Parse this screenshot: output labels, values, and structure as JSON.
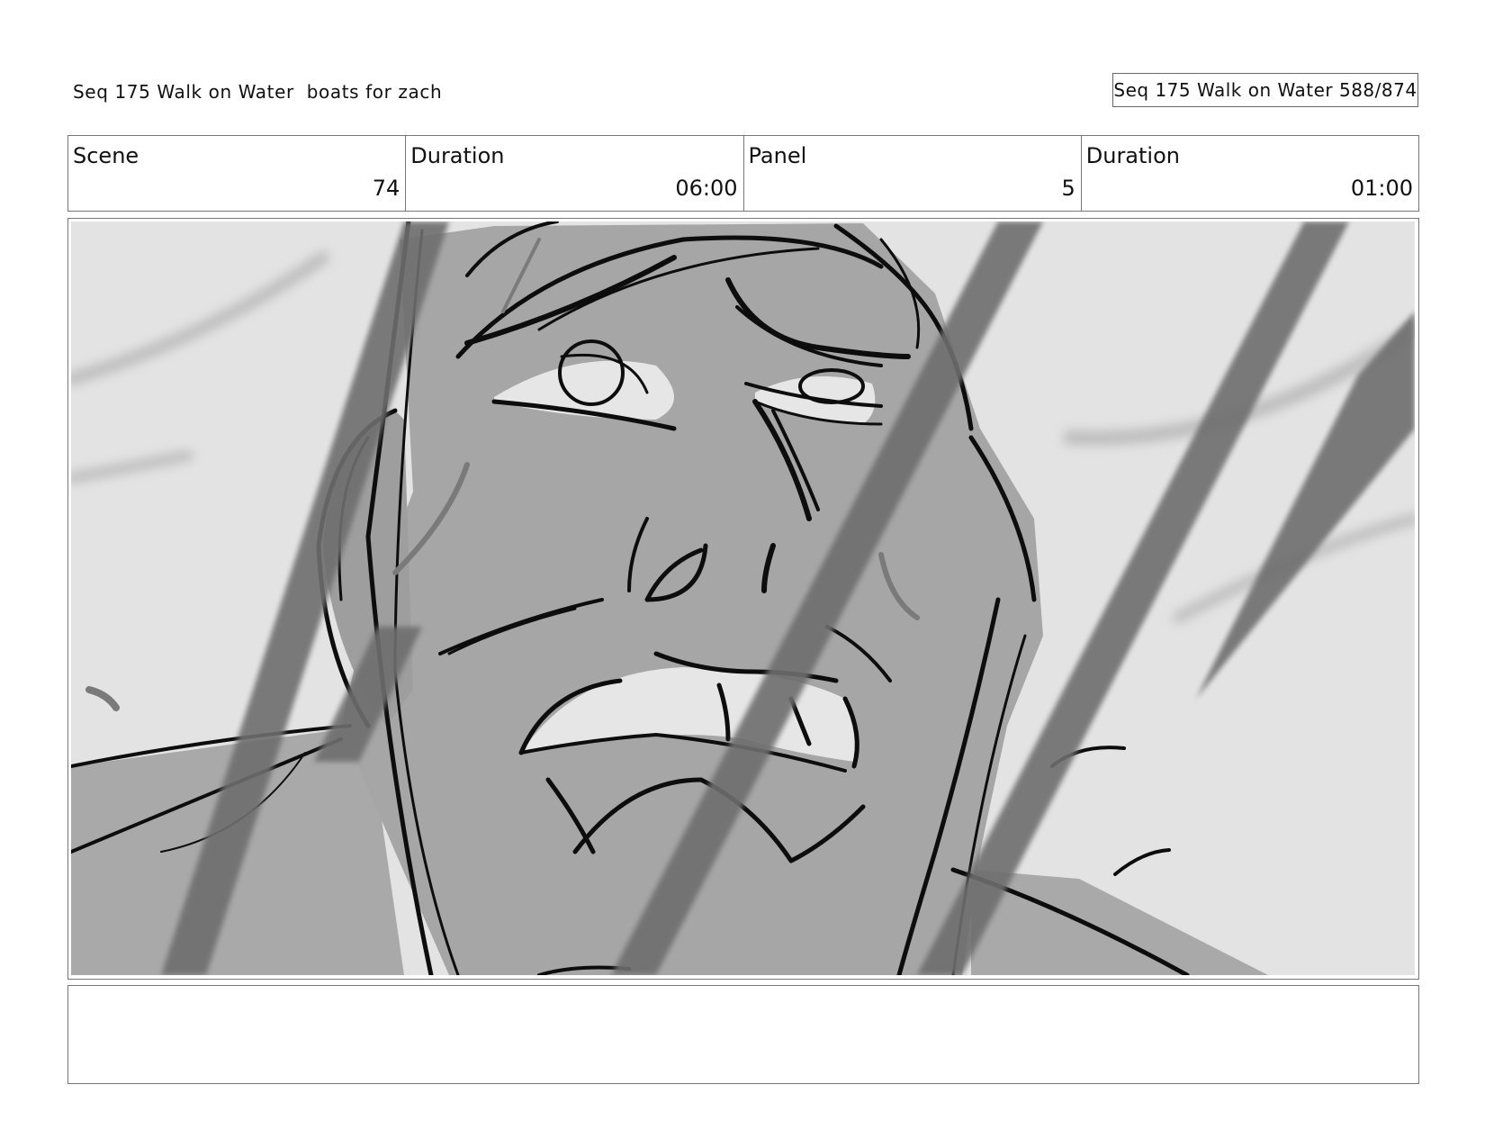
{
  "header": {
    "title": "Seq 175 Walk on Water  boats for zach",
    "page_label": "Seq 175 Walk on Water 588/874"
  },
  "info": {
    "scene_label": "Scene",
    "scene_value": "74",
    "scene_duration_label": "Duration",
    "scene_duration_value": "06:00",
    "panel_label": "Panel",
    "panel_value": "5",
    "panel_duration_label": "Duration",
    "panel_duration_value": "01:00"
  },
  "notes": {
    "text": ""
  }
}
